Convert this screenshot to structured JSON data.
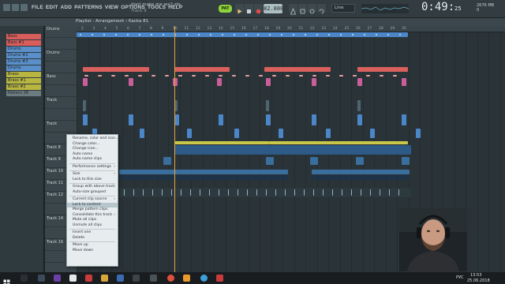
{
  "menu": [
    "FILE",
    "EDIT",
    "ADD",
    "PATTERNS",
    "VIEW",
    "OPTIONS",
    "TOOLS",
    "HELP"
  ],
  "song": {
    "title": "dont make me wa2.zip",
    "subtitle": "Track 9"
  },
  "transport": {
    "mode_label": "PAT",
    "tempo": "82.000",
    "snap": "Line",
    "time": "0:49:",
    "time_small": "25"
  },
  "cpu": {
    "line1": "2676 MB",
    "line2": "0"
  },
  "playlist": {
    "title": "Playlist - Arrangement › Kacka 81"
  },
  "picker": [
    {
      "label": "Bass",
      "color": "#d95e5b"
    },
    {
      "label": "Bass #1",
      "color": "#d95e5b"
    },
    {
      "label": "Drums",
      "color": "#5a8fc9"
    },
    {
      "label": "Drums #2",
      "color": "#5a8fc9"
    },
    {
      "label": "Drums #3",
      "color": "#5a8fc9"
    },
    {
      "label": "Drums",
      "color": "#5a8fc9"
    },
    {
      "label": "Brass",
      "color": "#b8b640"
    },
    {
      "label": "Brass #1",
      "color": "#b8b640"
    },
    {
      "label": "Brass #2",
      "color": "#b8b640"
    },
    {
      "label": "Pattern 38",
      "color": "#6c7b80"
    }
  ],
  "tracks": [
    "Drums",
    "",
    "Drums",
    "",
    "Bass",
    "",
    "Track",
    "",
    "Track",
    "",
    "Track 8",
    "Track 9",
    "Track 10",
    "Track 11",
    "Track 12",
    "",
    "Track 14",
    "",
    "Track 16",
    "",
    ""
  ],
  "ruler": [
    "2",
    "3",
    "4",
    "5",
    "6",
    "7",
    "8",
    "9",
    "10",
    "11",
    "12",
    "13",
    "14",
    "15",
    "16",
    "17",
    "18",
    "19",
    "20",
    "21",
    "22",
    "23",
    "24",
    "25",
    "26",
    "27",
    "28",
    "29",
    "30"
  ],
  "context_menu": {
    "items": [
      {
        "label": "Rename, color and icon...",
        "arrow": false,
        "hl": false
      },
      {
        "label": "Change color...",
        "arrow": false,
        "hl": false
      },
      {
        "label": "Change icon...",
        "arrow": false,
        "hl": false
      },
      {
        "label": "Auto name",
        "arrow": false,
        "hl": false
      },
      {
        "label": "Auto name clips",
        "arrow": false,
        "hl": false
      },
      {
        "sep": true
      },
      {
        "label": "Performance settings",
        "arrow": true,
        "hl": false
      },
      {
        "sep": true
      },
      {
        "label": "Size",
        "arrow": true,
        "hl": false
      },
      {
        "label": "Lock to this size",
        "arrow": false,
        "hl": false
      },
      {
        "sep": true
      },
      {
        "label": "Group with above track",
        "arrow": false,
        "hl": false
      },
      {
        "label": "Auto-size grouped",
        "arrow": false,
        "hl": false
      },
      {
        "sep": true
      },
      {
        "label": "Current clip source",
        "arrow": true,
        "hl": false
      },
      {
        "label": "Lock to content",
        "arrow": false,
        "hl": true
      },
      {
        "label": "Merge pattern clips",
        "arrow": false,
        "hl": false
      },
      {
        "label": "Consolidate this track",
        "arrow": true,
        "hl": false
      },
      {
        "label": "Mute all clips",
        "arrow": false,
        "hl": false
      },
      {
        "label": "Unmute all clips",
        "arrow": false,
        "hl": false
      },
      {
        "sep": true
      },
      {
        "label": "Insert one",
        "arrow": false,
        "hl": false
      },
      {
        "label": "Delete",
        "arrow": false,
        "hl": false
      },
      {
        "sep": true
      },
      {
        "label": "Move up",
        "arrow": false,
        "hl": false
      },
      {
        "label": "Move down",
        "arrow": false,
        "hl": false
      }
    ]
  },
  "taskbar": {
    "lang": "РУС",
    "time": "13:53",
    "date": "25.06.2018"
  },
  "colors": {
    "drums_clip": "#4b86c8",
    "bass_clip": "#d9605d",
    "pink_clip": "#c95f9a",
    "yellow_clip": "#c8c84a",
    "accent": "#8fd33a"
  }
}
